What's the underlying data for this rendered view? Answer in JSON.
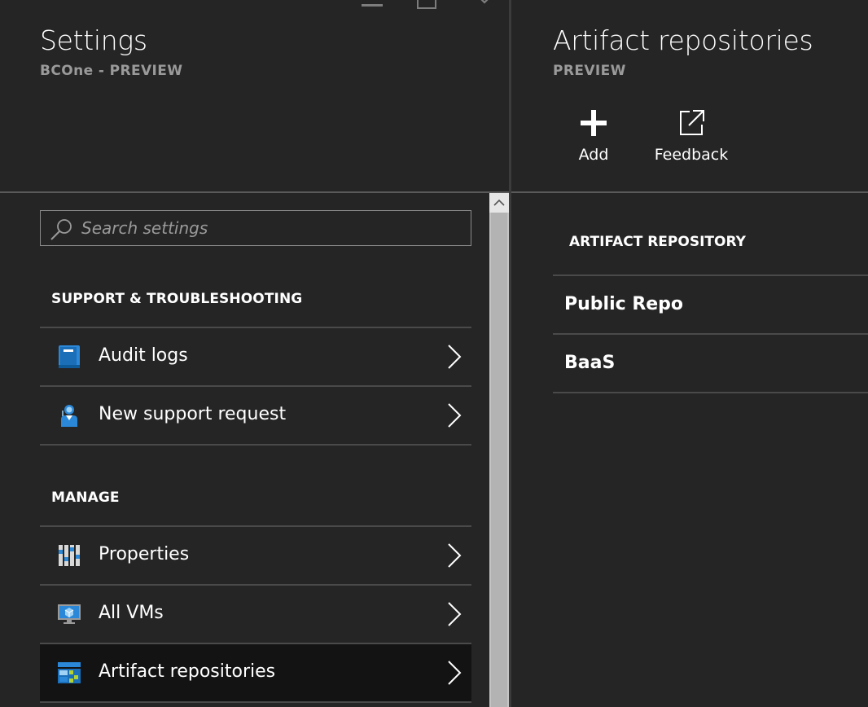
{
  "settings_blade": {
    "title": "Settings",
    "subtitle": "BCOne - PREVIEW",
    "search": {
      "placeholder": "Search settings",
      "value": ""
    },
    "sections": [
      {
        "header": "SUPPORT & TROUBLESHOOTING",
        "items": [
          {
            "label": "Audit logs",
            "icon": "audit-logs-icon"
          },
          {
            "label": "New support request",
            "icon": "support-request-icon"
          }
        ]
      },
      {
        "header": "MANAGE",
        "items": [
          {
            "label": "Properties",
            "icon": "properties-icon"
          },
          {
            "label": "All VMs",
            "icon": "all-vms-icon"
          },
          {
            "label": "Artifact repositories",
            "icon": "artifact-repositories-icon",
            "selected": true
          }
        ]
      }
    ]
  },
  "artifact_blade": {
    "title": "Artifact repositories",
    "subtitle": "PREVIEW",
    "commands": [
      {
        "label": "Add",
        "icon": "plus-icon"
      },
      {
        "label": "Feedback",
        "icon": "external-link-icon"
      }
    ],
    "table": {
      "column_header": "ARTIFACT REPOSITORY",
      "rows": [
        "Public Repo",
        "BaaS"
      ]
    }
  },
  "colors": {
    "background": "#252525",
    "selected_row": "#131313",
    "divider": "#4a4a4a",
    "subtitle": "#9a9a9a",
    "accent_blue": "#2b88d8",
    "accent_yellow": "#b5d334"
  }
}
